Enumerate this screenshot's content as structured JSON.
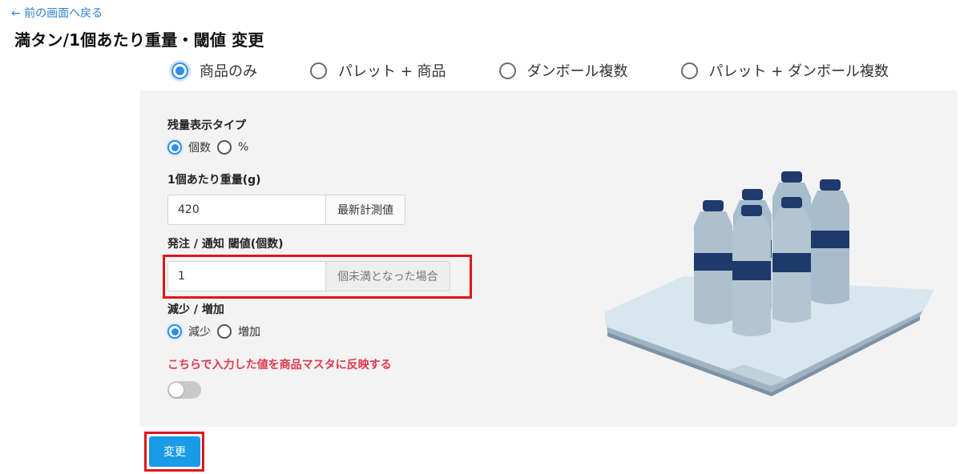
{
  "nav": {
    "back_label": "← 前の画面へ戻る"
  },
  "page": {
    "title": "満タン/1個あたり重量・閾値 変更"
  },
  "modes": [
    {
      "label": "商品のみ",
      "selected": true
    },
    {
      "label": "パレット + 商品",
      "selected": false
    },
    {
      "label": "ダンボール複数",
      "selected": false
    },
    {
      "label": "パレット + ダンボール複数",
      "selected": false
    }
  ],
  "form": {
    "display_type": {
      "label": "残量表示タイプ",
      "options": [
        {
          "label": "個数",
          "selected": true
        },
        {
          "label": "%",
          "selected": false
        }
      ]
    },
    "unit_weight": {
      "label": "1個あたり重量(g)",
      "value": "420",
      "addon_label": "最新計測値"
    },
    "threshold": {
      "label": "発注 / 通知 閾値(個数)",
      "value": "1",
      "addon_label": "個未満となった場合"
    },
    "direction": {
      "label": "減少 / 増加",
      "options": [
        {
          "label": "減少",
          "selected": true
        },
        {
          "label": "増加",
          "selected": false
        }
      ]
    },
    "sync_notice": "こちらで入力した値を商品マスタに反映する",
    "sync_toggle_on": false
  },
  "actions": {
    "submit_label": "変更"
  },
  "colors": {
    "accent": "#2f8de4",
    "button": "#1a9be8",
    "highlight": "#e0151b",
    "notice": "#e0384c",
    "panel": "#f3f3f3"
  }
}
